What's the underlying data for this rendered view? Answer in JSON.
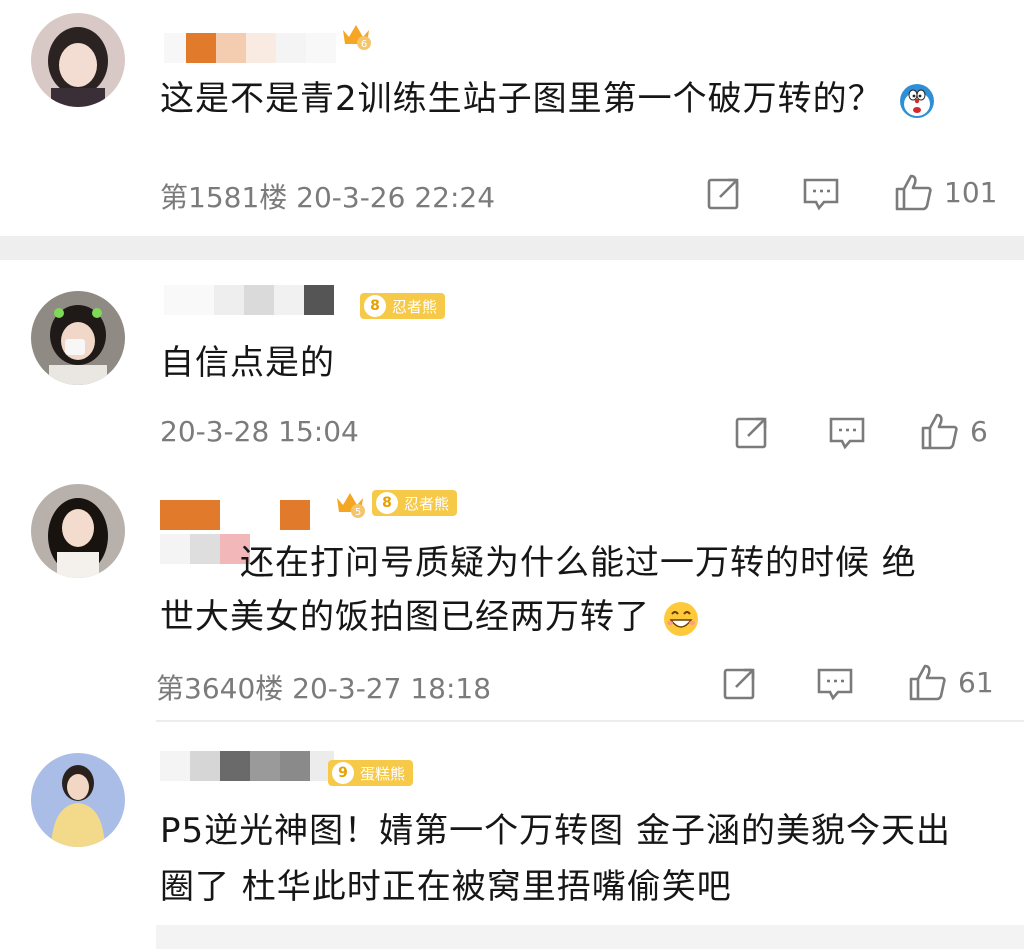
{
  "comments": [
    {
      "text": "这是不是青2训练生站子图里第一个破万转的？",
      "meta": "第1581楼  20-3-26  22:24",
      "likes": "101",
      "badge_text": "",
      "crown_level": "6"
    },
    {
      "text": "自信点是的",
      "meta": "20-3-28  15:04",
      "likes": "6",
      "badge_level": "8",
      "badge_text": "忍者熊"
    },
    {
      "text_line1": "还在打问号质疑为什么能过一万转的时候 绝",
      "text_line2": "世大美女的饭拍图已经两万转了",
      "meta": "第3640楼  20-3-27  18:18",
      "likes": "61",
      "crown_level": "5",
      "badge_level": "8",
      "badge_text": "忍者熊"
    },
    {
      "text_line1": "P5逆光神图！婧第一个万转图 金子涵的美貌今天出",
      "text_line2": "圈了 杜华此时正在被窝里捂嘴偷笑吧",
      "badge_level": "9",
      "badge_text": "蛋糕熊"
    }
  ],
  "icons": {
    "share": "share-icon",
    "comment": "comment-icon",
    "like": "thumbs-up-icon",
    "emoji_surprise": "doraemon-emoji-icon",
    "emoji_laugh": "grin-emoji-icon"
  },
  "colors": {
    "badge": "#f7c948",
    "meta_text": "#7b7b7b",
    "separator": "#eeeeee"
  }
}
